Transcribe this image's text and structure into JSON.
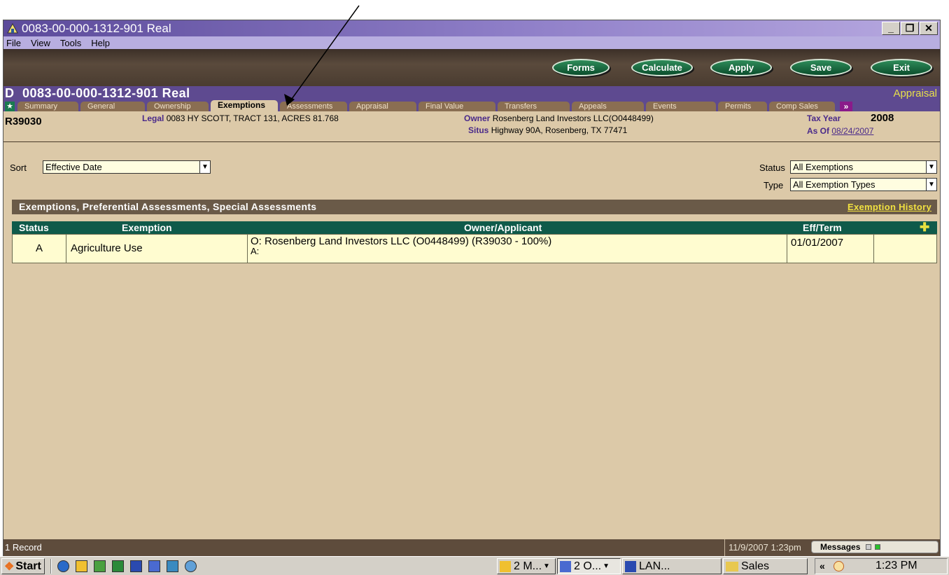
{
  "window": {
    "title": "0083-00-000-1312-901 Real",
    "controls": [
      "_",
      "❐",
      "✕"
    ]
  },
  "menu": [
    "File",
    "View",
    "Tools",
    "Help"
  ],
  "toolbar": {
    "forms": "Forms",
    "calculate": "Calculate",
    "apply": "Apply",
    "save": "Save",
    "exit": "Exit"
  },
  "record": {
    "prefix": "D",
    "title": "0083-00-000-1312-901 Real",
    "mode": "Appraisal"
  },
  "tabs": [
    "Summary",
    "General",
    "Ownership",
    "Exemptions",
    "Assessments",
    "Appraisal",
    "Final Value",
    "Transfers",
    "Appeals",
    "Events",
    "Permits",
    "Comp Sales"
  ],
  "active_tab": "Exemptions",
  "info": {
    "id": "R39030",
    "legal_label": "Legal",
    "legal": "0083 HY SCOTT, TRACT 131, ACRES 81.768",
    "owner_label": "Owner",
    "owner": "Rosenberg Land Investors LLC(O0448499)",
    "situs_label": "Situs",
    "situs": "Highway 90A, Rosenberg, TX 77471",
    "tax_year_label": "Tax Year",
    "tax_year": "2008",
    "as_of_label": "As Of",
    "as_of": "08/24/2007"
  },
  "filters": {
    "sort_label": "Sort",
    "sort_value": "Effective Date",
    "status_label": "Status",
    "status_value": "All Exemptions",
    "type_label": "Type",
    "type_value": "All Exemption Types"
  },
  "section": {
    "title": "Exemptions, Preferential Assessments, Special Assessments",
    "history_link": "Exemption History"
  },
  "grid": {
    "columns": [
      "Status",
      "Exemption",
      "Owner/Applicant",
      "Eff/Term"
    ],
    "rows": [
      {
        "status": "A",
        "exemption": "Agriculture Use",
        "owner": "O: Rosenberg Land Investors LLC (O0448499) (R39030 - 100%)",
        "applicant": "A:",
        "eff_term": "01/01/2007"
      }
    ]
  },
  "status_bar": {
    "records": "1 Record",
    "datetime": "11/9/2007 1:23pm",
    "messages": "Messages"
  },
  "taskbar": {
    "start": "Start",
    "items": [
      "2 M...",
      "2 O...",
      "LAN...",
      "Sales"
    ],
    "clock": "1:23 PM",
    "expand": "«"
  },
  "colors": {
    "window_bg": "#dcc9a8",
    "title_purple": "#5e4a90",
    "grid_header": "#0f5a4a",
    "row_bg": "#fffcd0",
    "link_yellow": "#f0e040"
  }
}
